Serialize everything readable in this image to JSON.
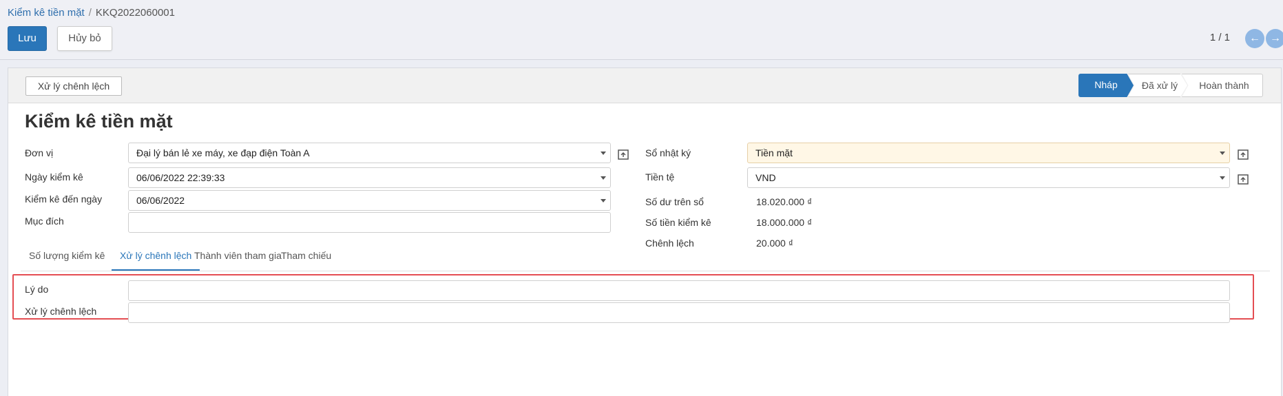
{
  "breadcrumb": {
    "parent": "Kiểm kê tiền mặt",
    "separator": "/",
    "current": "KKQ2022060001"
  },
  "toolbar": {
    "save_label": "Lưu",
    "cancel_label": "Hủy bỏ"
  },
  "pager": {
    "value": "1 / 1",
    "prev_icon": "arrow-left-icon",
    "next_icon": "arrow-right-icon",
    "prev_glyph": "←",
    "next_glyph": "→"
  },
  "header": {
    "action_button": "Xử lý chênh lệch",
    "statuses": [
      "Nháp",
      "Đã xử lý",
      "Hoàn thành"
    ],
    "active_status": "Nháp"
  },
  "form": {
    "title": "Kiểm kê tiền mặt",
    "left": {
      "don_vi": {
        "label": "Đơn vị",
        "value": "Đại lý bán lẻ xe máy, xe đạp điện Toàn A"
      },
      "ngay_kiem_ke": {
        "label": "Ngày kiểm kê",
        "value": "06/06/2022 22:39:33"
      },
      "kiem_ke_den_ngay": {
        "label": "Kiểm kê đến ngày",
        "value": "06/06/2022"
      },
      "muc_dich": {
        "label": "Mục đích",
        "value": ""
      }
    },
    "right": {
      "so_nhat_ky": {
        "label": "Sổ nhật ký",
        "value": "Tiền mặt"
      },
      "tien_te": {
        "label": "Tiền tệ",
        "value": "VND"
      },
      "so_du_tren_so": {
        "label": "Số dư trên sổ",
        "value": "18.020.000 ₫"
      },
      "so_tien_kiem_ke": {
        "label": "Số tiền kiểm kê",
        "value": "18.000.000 ₫"
      },
      "chenh_lech": {
        "label": "Chênh lệch",
        "value": "20.000 ₫"
      }
    }
  },
  "tabs": [
    "Số lượng kiểm kê",
    "Xử lý chênh lệch",
    "Thành viên tham gia",
    "Tham chiếu"
  ],
  "active_tab": "Xử lý chênh lệch",
  "tab_content": {
    "ly_do": {
      "label": "Lý do",
      "value": ""
    },
    "xu_ly_chenh_lech": {
      "label": "Xử lý chênh lệch",
      "value": ""
    }
  },
  "colors": {
    "primary": "#2a76b9",
    "highlight_border": "#e44d52",
    "required_field_bg": "#fff7e6"
  }
}
